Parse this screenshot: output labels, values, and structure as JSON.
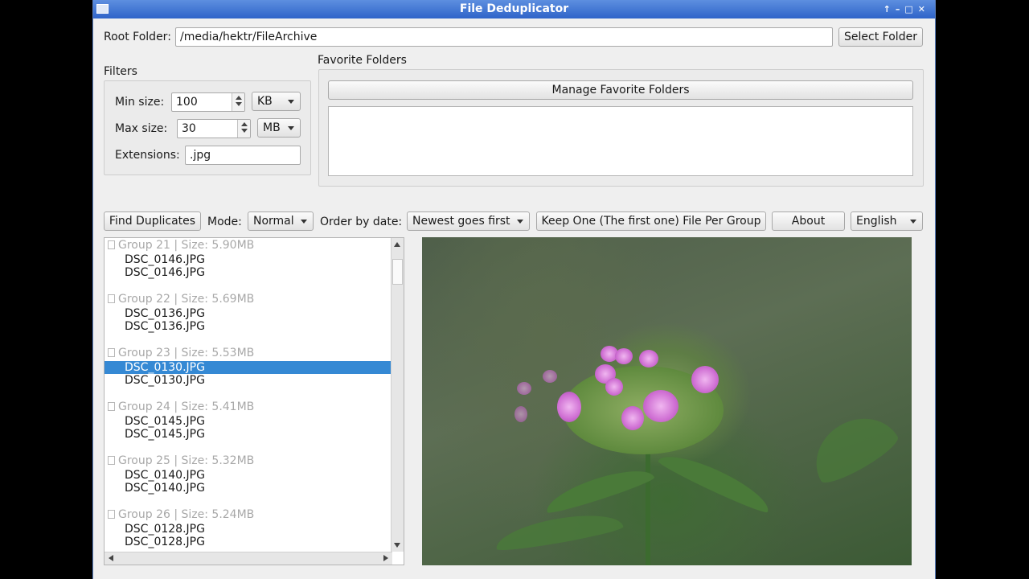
{
  "window": {
    "title": "File Deduplicator"
  },
  "root": {
    "label": "Root Folder:",
    "value": "/media/hektr/FileArchive",
    "select_button": "Select Folder"
  },
  "filters": {
    "title": "Filters",
    "min_label": "Min size:",
    "min_value": "100",
    "min_unit": "KB",
    "max_label": "Max size:",
    "max_value": "30",
    "max_unit": "MB",
    "ext_label": "Extensions:",
    "ext_value": ".jpg"
  },
  "favorites": {
    "title": "Favorite Folders",
    "manage_button": "Manage Favorite Folders"
  },
  "toolbar": {
    "find_button": "Find Duplicates",
    "mode_label": "Mode:",
    "mode_value": "Normal",
    "order_label": "Order by date:",
    "order_value": "Newest goes first",
    "keep_button": "Keep One (The first one) File Per Group",
    "about_button": "About",
    "language_value": "English"
  },
  "groups": [
    {
      "label": "Group 21 | Size: 5.90MB",
      "files": [
        "DSC_0146.JPG",
        "DSC_0146.JPG"
      ]
    },
    {
      "label": "Group 22 | Size: 5.69MB",
      "files": [
        "DSC_0136.JPG",
        "DSC_0136.JPG"
      ]
    },
    {
      "label": "Group 23 | Size: 5.53MB",
      "files": [
        "DSC_0130.JPG",
        "DSC_0130.JPG"
      ]
    },
    {
      "label": "Group 24 | Size: 5.41MB",
      "files": [
        "DSC_0145.JPG",
        "DSC_0145.JPG"
      ]
    },
    {
      "label": "Group 25 | Size: 5.32MB",
      "files": [
        "DSC_0140.JPG",
        "DSC_0140.JPG"
      ]
    },
    {
      "label": "Group 26 | Size: 5.24MB",
      "files": [
        "DSC_0128.JPG",
        "DSC_0128.JPG"
      ]
    }
  ],
  "selected_file": "DSC_0130.JPG"
}
